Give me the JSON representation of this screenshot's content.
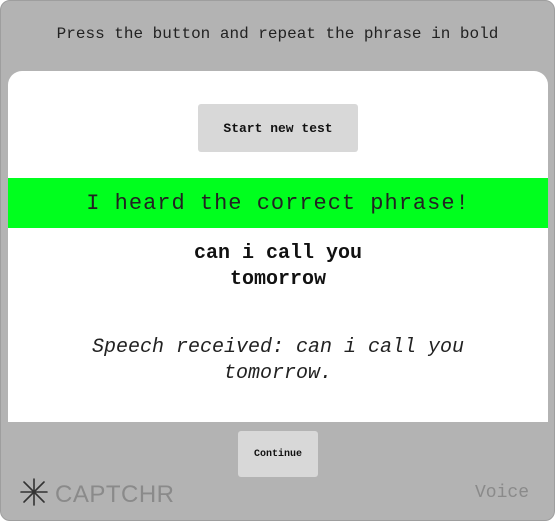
{
  "header": {
    "instruction": "Press the button and repeat the phrase in bold"
  },
  "panel": {
    "start_button_label": "Start new test",
    "result_banner": "I heard the correct phrase!",
    "target_phrase_line1": "can i call you",
    "target_phrase_line2": "tomorrow",
    "speech_line1": "Speech received: can i call you",
    "speech_line2": "tomorrow."
  },
  "footer": {
    "continue_label": "Continue",
    "brand": "CAPTCHR",
    "mode": "Voice"
  },
  "colors": {
    "frame_bg": "#b3b3b3",
    "success_banner": "#00ff1e",
    "button_bg": "#d8d8d8",
    "brand_gray": "#8a8a8a"
  },
  "icons": {
    "logo": "asterisk-star-icon"
  }
}
